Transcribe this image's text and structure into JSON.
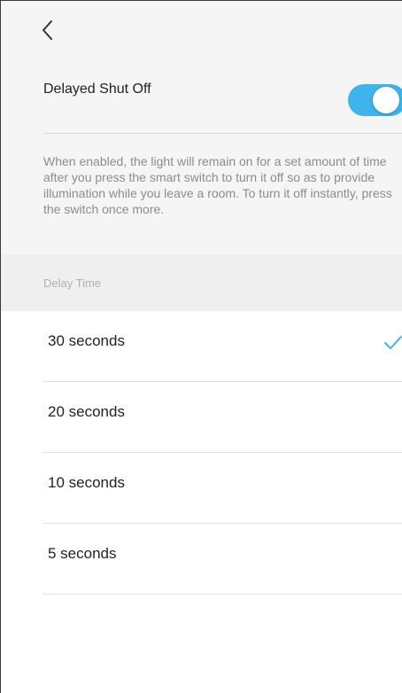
{
  "nav": {
    "back_icon": "chevron-left-icon"
  },
  "setting": {
    "label": "Delayed Shut Off",
    "enabled": true,
    "toggle_color": "#3fb3ec"
  },
  "description": "When enabled, the light will remain on for a set amount of time after you press the smart switch to turn it off so as to provide illumination while you leave a room. To turn it off instantly, press the switch once more.",
  "delay_section": {
    "header": "Delay Time",
    "options": [
      {
        "label": "30 seconds",
        "selected": true
      },
      {
        "label": "20 seconds",
        "selected": false
      },
      {
        "label": "10 seconds",
        "selected": false
      },
      {
        "label": "5 seconds",
        "selected": false
      }
    ],
    "check_icon": "checkmark-icon",
    "check_color": "#3fb3ec"
  }
}
